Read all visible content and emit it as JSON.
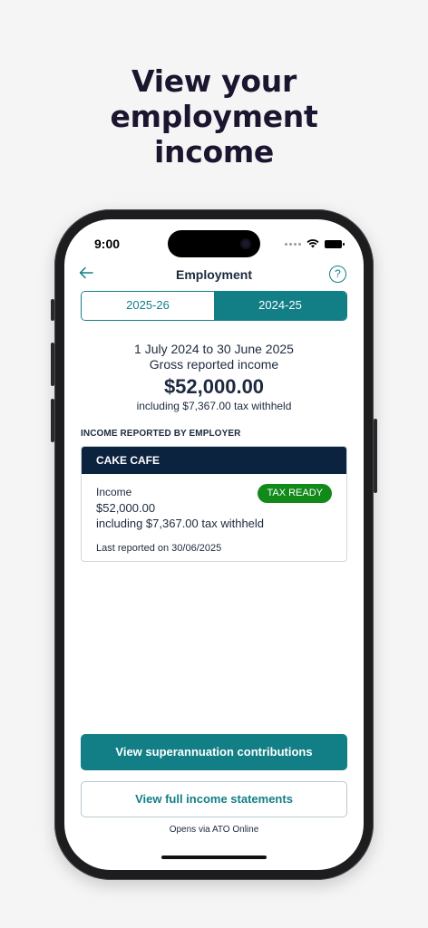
{
  "headline": [
    "View your",
    "employment",
    "income"
  ],
  "status_bar": {
    "time": "9:00"
  },
  "nav": {
    "back_icon": "arrow-left-icon",
    "title": "Employment",
    "help_label": "?"
  },
  "year_tabs": [
    {
      "label": "2025-26",
      "selected": false
    },
    {
      "label": "2024-25",
      "selected": true
    }
  ],
  "summary": {
    "period": "1 July 2024 to 30 June 2025",
    "label": "Gross reported income",
    "amount": "$52,000.00",
    "tax_note": "including $7,367.00 tax withheld"
  },
  "section_title": "INCOME REPORTED BY EMPLOYER",
  "employer_card": {
    "employer": "CAKE CAFE",
    "income_label": "Income",
    "income_value": "$52,000.00",
    "tax_note": "including $7,367.00 tax withheld",
    "badge": "TAX READY",
    "last_reported": "Last reported on 30/06/2025"
  },
  "actions": {
    "super_button": "View superannuation contributions",
    "statements_button": "View full income statements",
    "footnote": "Opens via ATO Online"
  },
  "colors": {
    "primary": "#127f86",
    "navy": "#0c2340",
    "badge_green": "#118a1a"
  }
}
